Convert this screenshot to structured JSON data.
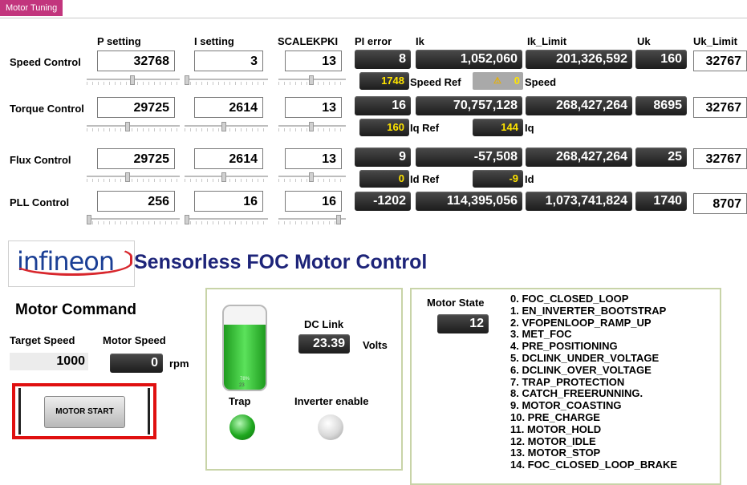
{
  "app": {
    "tab_title": "Motor Tuning"
  },
  "columns": {
    "p_setting": "P setting",
    "i_setting": "I setting",
    "scalekpki": "SCALEKPKI",
    "pi_error": "PI error",
    "ik": "Ik",
    "ik_limit": "Ik_Limit",
    "uk": "Uk",
    "uk_limit": "Uk_Limit"
  },
  "rows": [
    {
      "label": "Speed Control",
      "p": "32768",
      "i": "3",
      "scale": "13",
      "pi_error": "8",
      "ik": "1,052,060",
      "ik_limit": "201,326,592",
      "uk": "160",
      "uk_limit": "32767",
      "ref_value": "1748",
      "ref_label": "Speed Ref",
      "act_value": "0",
      "act_label": "Speed"
    },
    {
      "label": "Torque Control",
      "p": "29725",
      "i": "2614",
      "scale": "13",
      "pi_error": "16",
      "ik": "70,757,128",
      "ik_limit": "268,427,264",
      "uk": "8695",
      "uk_limit": "32767",
      "ref_value": "160",
      "ref_label": "Iq Ref",
      "act_value": "144",
      "act_label": "Iq"
    },
    {
      "label": "Flux Control",
      "p": "29725",
      "i": "2614",
      "scale": "13",
      "pi_error": "9",
      "ik": "-57,508",
      "ik_limit": "268,427,264",
      "uk": "25",
      "uk_limit": "32767",
      "ref_value": "0",
      "ref_label": "Id Ref",
      "act_value": "-9",
      "act_label": "Id"
    },
    {
      "label": "PLL Control",
      "p": "256",
      "i": "16",
      "scale": "16",
      "pi_error": "-1202",
      "ik": "114,395,056",
      "ik_limit": "1,073,741,824",
      "uk": "1740",
      "uk_limit": "8707"
    }
  ],
  "brand": {
    "logo_text": "infineon",
    "title": "Sensorless FOC Motor Control",
    "logo_color": "#1b3f95",
    "title_color": "#1d2479"
  },
  "command": {
    "heading": "Motor Command",
    "target_speed_label": "Target Speed",
    "target_speed_value": "1000",
    "motor_speed_label": "Motor Speed",
    "motor_speed_value": "0",
    "rpm_label": "rpm",
    "start_button": "MOTOR START",
    "highlight_color": "#e01010"
  },
  "status": {
    "tank_level": 0.78,
    "tank_caption": "78%",
    "tank_sub": "23",
    "dc_link_label": "DC Link",
    "dc_link_value": "23.39",
    "volts_label": "Volts",
    "trap_label": "Trap",
    "inverter_label": "Inverter enable",
    "trap_color": "#1fa81f",
    "inverter_color": "#d9d9d9"
  },
  "motor_state": {
    "label": "Motor State",
    "value": "12",
    "states": [
      "0. FOC_CLOSED_LOOP",
      "1. EN_INVERTER_BOOTSTRAP",
      "2. VFOPENLOOP_RAMP_UP",
      "3. MET_FOC",
      "4. PRE_POSITIONING",
      "5. DCLINK_UNDER_VOLTAGE",
      "6. DCLINK_OVER_VOLTAGE",
      "7. TRAP_PROTECTION",
      "8. CATCH_FREERUNNING.",
      "9. MOTOR_COASTING",
      "10. PRE_CHARGE",
      "11. MOTOR_HOLD",
      "12. MOTOR_IDLE",
      "13. MOTOR_STOP",
      "14. FOC_CLOSED_LOOP_BRAKE"
    ]
  }
}
